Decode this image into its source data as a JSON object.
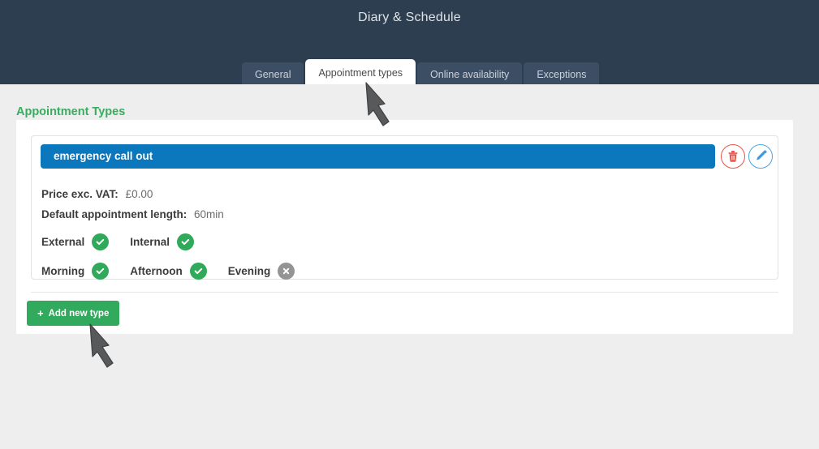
{
  "header": {
    "title": "Diary & Schedule",
    "bg_color": "#2d3e50"
  },
  "tabs": [
    {
      "label": "General",
      "active": false
    },
    {
      "label": "Appointment types",
      "active": true
    },
    {
      "label": "Online availability",
      "active": false
    },
    {
      "label": "Exceptions",
      "active": false
    }
  ],
  "main": {
    "section_title": "Appointment Types",
    "section_title_color": "#3aab5f",
    "appointment_type": {
      "name": "emergency call out",
      "name_bar_color": "#0b77bd",
      "details": [
        {
          "label": "Price exc. VAT:",
          "value": "£0.00"
        },
        {
          "label": "Default appointment length:",
          "value": "60min"
        }
      ],
      "flags_row_1": [
        {
          "label": "External",
          "enabled": true
        },
        {
          "label": "Internal",
          "enabled": true
        }
      ],
      "flags_row_2": [
        {
          "label": "Morning",
          "enabled": true
        },
        {
          "label": "Afternoon",
          "enabled": true
        },
        {
          "label": "Evening",
          "enabled": false
        }
      ],
      "actions": [
        {
          "name": "delete",
          "icon": "trash-icon",
          "color": "#e8534a"
        },
        {
          "name": "edit",
          "icon": "pencil-icon",
          "color": "#4da3e0"
        }
      ]
    },
    "add_button": {
      "icon": "plus-icon",
      "plus": "+",
      "label": "Add new type",
      "color": "#31aa5e"
    }
  },
  "annotations": [
    {
      "name": "arrow-pointing-to-appointment-types-tab",
      "direction": "up-left"
    },
    {
      "name": "arrow-pointing-to-add-new-type-button",
      "direction": "up-left"
    }
  ],
  "badge_colors": {
    "enabled": "#31a95a",
    "disabled": "#949494"
  }
}
